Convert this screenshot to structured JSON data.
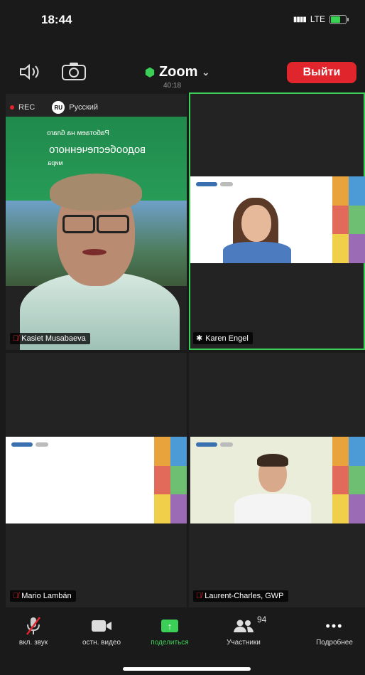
{
  "status": {
    "time": "18:44",
    "network": "LTE"
  },
  "header": {
    "app_title": "Zoom",
    "timer": "40:18",
    "leave_label": "Выйти"
  },
  "recording": {
    "rec_label": "REC",
    "lang_code": "RU",
    "language": "Русский"
  },
  "participants": [
    {
      "name": "Kasiet Musabaeva",
      "muted": true
    },
    {
      "name": "Karen Engel",
      "muted": false
    },
    {
      "name": "Mario Lambán",
      "muted": true
    },
    {
      "name": "Laurent-Charles, GWP",
      "muted": true
    }
  ],
  "slide_text": {
    "line1": "Работаем на благо",
    "line2": "водообеспеченного",
    "line3": "мира"
  },
  "toolbar": {
    "unmute_label": "вкл. звук",
    "stop_video_label": "остн. видео",
    "share_label": "поделиться",
    "participants_label": "Участники",
    "participants_count": "94",
    "more_label": "Подробнее"
  },
  "colors": {
    "accent_green": "#3ccf57",
    "leave_red": "#e0262c"
  }
}
